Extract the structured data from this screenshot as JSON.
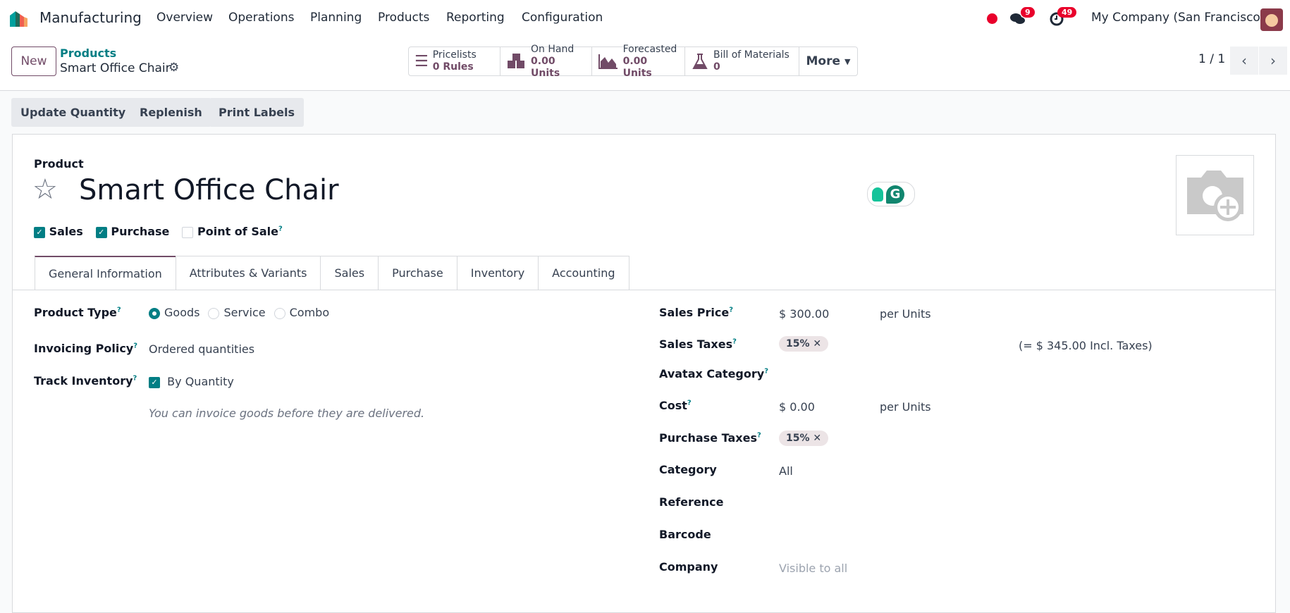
{
  "navbar": {
    "app_name": "Manufacturing",
    "menus": [
      "Overview",
      "Operations",
      "Planning",
      "Products",
      "Reporting",
      "Configuration"
    ],
    "messages_count": "9",
    "activities_count": "49",
    "company": "My Company (San Francisco)"
  },
  "control_panel": {
    "new_label": "New",
    "breadcrumb_parent": "Products",
    "breadcrumb_current": "Smart Office Chair",
    "pager": "1 / 1",
    "smart_buttons": [
      {
        "label": "Pricelists",
        "value": "0 Rules"
      },
      {
        "label": "On Hand",
        "value": "0.00 Units"
      },
      {
        "label": "Forecasted",
        "value": "0.00 Units"
      },
      {
        "label": "Bill of Materials",
        "value": "0"
      }
    ],
    "more_label": "More"
  },
  "actions": [
    "Update Quantity",
    "Replenish",
    "Print Labels"
  ],
  "form": {
    "product_label": "Product",
    "name": "Smart Office Chair",
    "flags": [
      {
        "label": "Sales",
        "checked": true
      },
      {
        "label": "Purchase",
        "checked": true
      },
      {
        "label": "Point of Sale",
        "checked": false
      }
    ],
    "help": "?",
    "tabs": [
      "General Information",
      "Attributes & Variants",
      "Sales",
      "Purchase",
      "Inventory",
      "Accounting"
    ],
    "left": {
      "product_type_label": "Product Type",
      "types": [
        "Goods",
        "Service",
        "Combo"
      ],
      "selected_type": "Goods",
      "invoicing_label": "Invoicing Policy",
      "invoicing_value": "Ordered quantities",
      "track_label": "Track Inventory",
      "track_value": "By Quantity",
      "note": "You can invoice goods before they are delivered."
    },
    "right": {
      "sales_price_label": "Sales Price",
      "sales_price": "$ 300.00",
      "per_units": "per Units",
      "sales_taxes_label": "Sales Taxes",
      "sales_tax_tag": "15%",
      "incl_taxes": "(= $ 345.00 Incl. Taxes)",
      "avatax_label": "Avatax Category",
      "cost_label": "Cost",
      "cost": "$ 0.00",
      "purchase_taxes_label": "Purchase Taxes",
      "purchase_tax_tag": "15%",
      "category_label": "Category",
      "category": "All",
      "reference_label": "Reference",
      "barcode_label": "Barcode",
      "company_label": "Company",
      "company_value": "Visible to all"
    }
  },
  "colors": {
    "brand": "#714b67",
    "accent": "#017e84",
    "badge": "#e9002b"
  }
}
